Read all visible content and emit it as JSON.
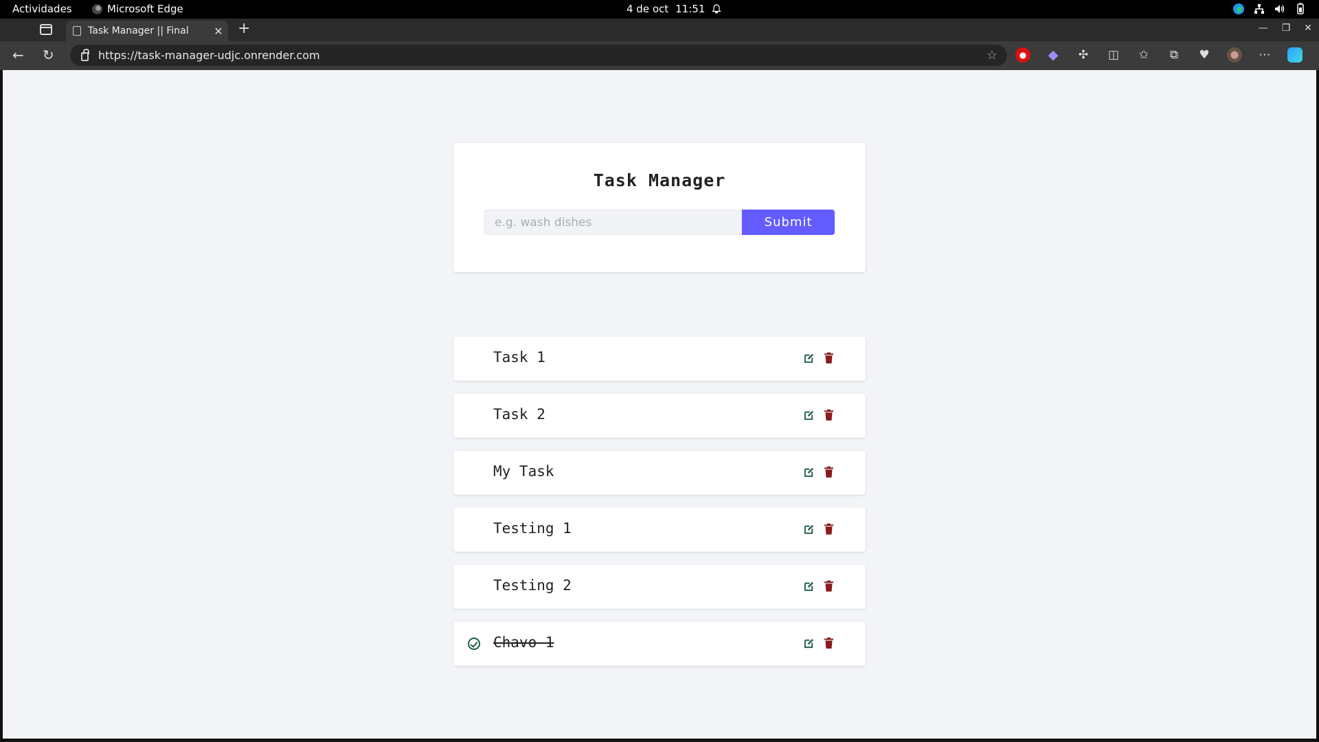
{
  "system_bar": {
    "activities": "Actividades",
    "app_name": "Microsoft Edge",
    "date": "4 de oct",
    "time": "11:51"
  },
  "browser": {
    "tab_title": "Task Manager || Final",
    "url": "https://task-manager-udjc.onrender.com"
  },
  "form": {
    "title": "Task Manager",
    "input_placeholder": "e.g. wash dishes",
    "input_value": "",
    "submit_label": "Submit"
  },
  "tasks": [
    {
      "name": "Task 1",
      "completed": false
    },
    {
      "name": "Task 2",
      "completed": false
    },
    {
      "name": "My Task",
      "completed": false
    },
    {
      "name": "Testing 1",
      "completed": false
    },
    {
      "name": "Testing 2",
      "completed": false
    },
    {
      "name": "Chavo 1",
      "completed": true
    }
  ],
  "colors": {
    "accent": "#645cff",
    "edit_icon": "#1e5b4a",
    "delete_icon": "#8b1c1c",
    "page_background": "#f2f4f7"
  },
  "icons": {
    "edit": "edit-icon",
    "delete": "trash-icon",
    "completed": "check-circle-icon"
  }
}
